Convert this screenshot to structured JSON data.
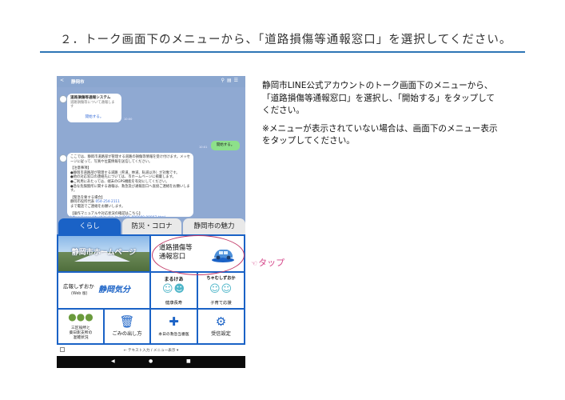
{
  "slide": {
    "title": "２．トーク画面下のメニューから、「道路損傷等通報窓口」を選択してください。",
    "instruction": "静岡市LINE公式アカウントのトーク画面下のメニューから、「道路損傷等通報窓口」を選択し、「開始する」をタップしてください。",
    "note": "※メニューが表示されていない場合は、画面下のメニュー表示をタップしてください。",
    "tap_label": "タップ",
    "accent_color": "#2e75b6",
    "tap_color": "#d64a8c"
  },
  "phone": {
    "header": {
      "back": "<",
      "account_name": "静岡市",
      "icons": [
        "search-icon",
        "list-icon",
        "menu-icon"
      ]
    },
    "chat": {
      "bubble1": {
        "title": "道路損傷等通報システム",
        "subtitle": "道路損傷等について通報します",
        "link": "開始する。"
      },
      "bubble1_time": "10:00",
      "user_message": "開始する。",
      "user_time": "10:01",
      "bubble2": {
        "line1": "ここでは、静岡市道路部が管理する道路の損傷等情報を受け付けます。メッセージに従って、写真や位置情報を送信してください。",
        "line2": "【注意事項】",
        "line3": "●静岡市道路部が管理する道路（県道、林道、私道以外）が対象です。",
        "line4": "●他の対応窓口の連絡先については、市ホームページに掲載します。",
        "line5": "●ご利用にあたっては、端末のGPS機能を有効にしてください。",
        "line6": "●急な危険箇所に関する通報は、救急及び通報窓口へ直接ご連絡をお願いします。",
        "line7": "【緊急を要する場合】",
        "line8": "静岡市役所代表",
        "phone": "054-254-2111",
        "line9": "まで電話でご連絡をお願いします。",
        "line10": "【操作マニュアルや対応状況の確認はこちら】",
        "url": "https://www.city.shizuoka.lg.jp/000_000000.00007.html"
      }
    },
    "tabs": [
      "くらし",
      "防災・コロナ",
      "静岡市の魅力"
    ],
    "menu": {
      "hp": "静岡市ホームページ",
      "road": "道路損傷等\n通報窓口",
      "koho": "広報しずおか",
      "koho_sub": "(Web 版)",
      "koho_logo": "静岡気分",
      "marukea": "まるけあ",
      "marukea_caption": "健康長寿",
      "chomushi": "ちゃむしずおか",
      "chomushi_caption": "子育て応援",
      "jam": "三区役所と\n葵日影支所の\n混雑状況",
      "gomi": "ごみの出し方",
      "kyukyu": "本日の救急当番医",
      "jushin": "受信設定"
    },
    "input_bar": "← テキスト入力 / メニュー表示 ▾",
    "nav": [
      "◀",
      "●",
      "■"
    ]
  }
}
